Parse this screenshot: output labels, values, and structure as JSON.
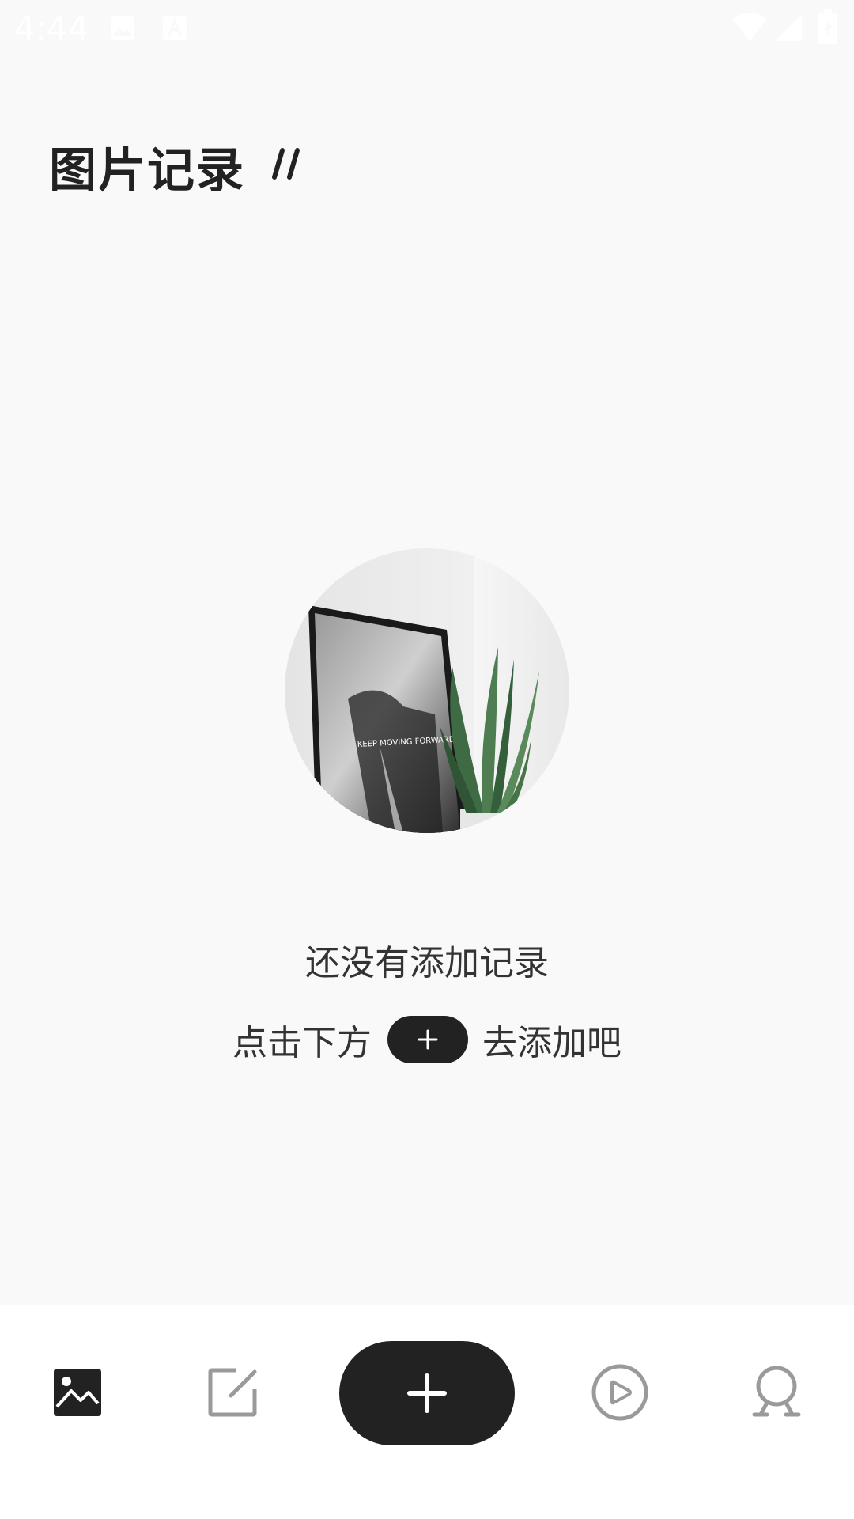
{
  "status_bar": {
    "time": "4:44",
    "icons": [
      "image-icon",
      "text-a-icon",
      "wifi-icon",
      "cell-signal-icon",
      "battery-charging-icon"
    ]
  },
  "header": {
    "title": "图片记录"
  },
  "empty_state": {
    "illustration_icon": "framed-poster-and-plant-photo",
    "message": "还没有添加记录",
    "hint_before": "点击下方",
    "hint_after": "去添加吧"
  },
  "bottom_nav": {
    "items": [
      {
        "icon": "image-icon",
        "active": true
      },
      {
        "icon": "edit-icon",
        "active": false
      },
      {
        "icon": "add-icon",
        "active": false
      },
      {
        "icon": "play-circle-icon",
        "active": false
      },
      {
        "icon": "profile-icon",
        "active": false
      }
    ]
  },
  "colors": {
    "background": "#f9f9f9",
    "nav_background": "#ffffff",
    "primary_dark": "#222222",
    "inactive_icon": "#9a9a9a",
    "text": "#333333"
  }
}
